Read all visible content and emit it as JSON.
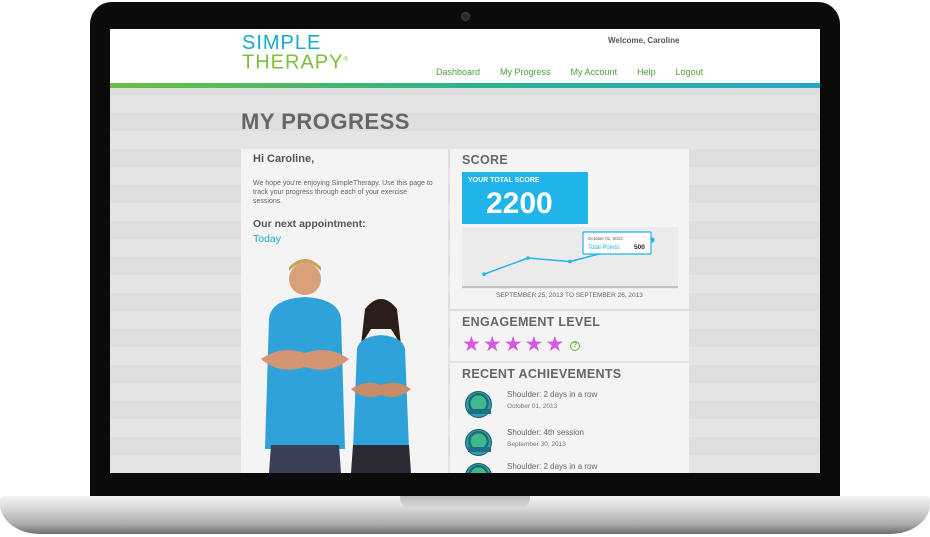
{
  "brand": {
    "line1": "SIMPLE",
    "line2": "THERAPY",
    "mark": "®"
  },
  "header": {
    "welcome": "Welcome, Caroline",
    "nav": [
      "Dashboard",
      "My Progress",
      "My Account",
      "Help",
      "Logout"
    ]
  },
  "page": {
    "title": "MY PROGRESS"
  },
  "left": {
    "greeting": "Hi Caroline,",
    "intro": "We hope you're enjoying SimpleTherapy. Use this page to track your progress through each of your exercise sessions.",
    "appointment_label": "Our next appointment:",
    "appointment_value": "Today"
  },
  "score": {
    "title": "SCORE",
    "total_label": "YOUR TOTAL SCORE",
    "total_value": "2200",
    "caption": "SEPTEMBER 25, 2013 TO SEPTEMBER 26, 2013",
    "tooltip_date": "October 01, 2013",
    "tooltip_label": "Total Points:",
    "tooltip_value": "500",
    "points": [
      120,
      300,
      260,
      500
    ],
    "colors": {
      "line": "#21b4ea",
      "box": "#21b4ea"
    }
  },
  "engagement": {
    "title": "ENGAGEMENT LEVEL",
    "stars": 5,
    "max": 5,
    "help": "?"
  },
  "achievements": {
    "title": "RECENT ACHIEVEMENTS",
    "items": [
      {
        "title": "Shoulder: 2 days in a row",
        "date": "October 01, 2013"
      },
      {
        "title": "Shoulder: 4th session",
        "date": "September 30, 2013"
      },
      {
        "title": "Shoulder: 2 days in a row",
        "date": ""
      }
    ]
  }
}
